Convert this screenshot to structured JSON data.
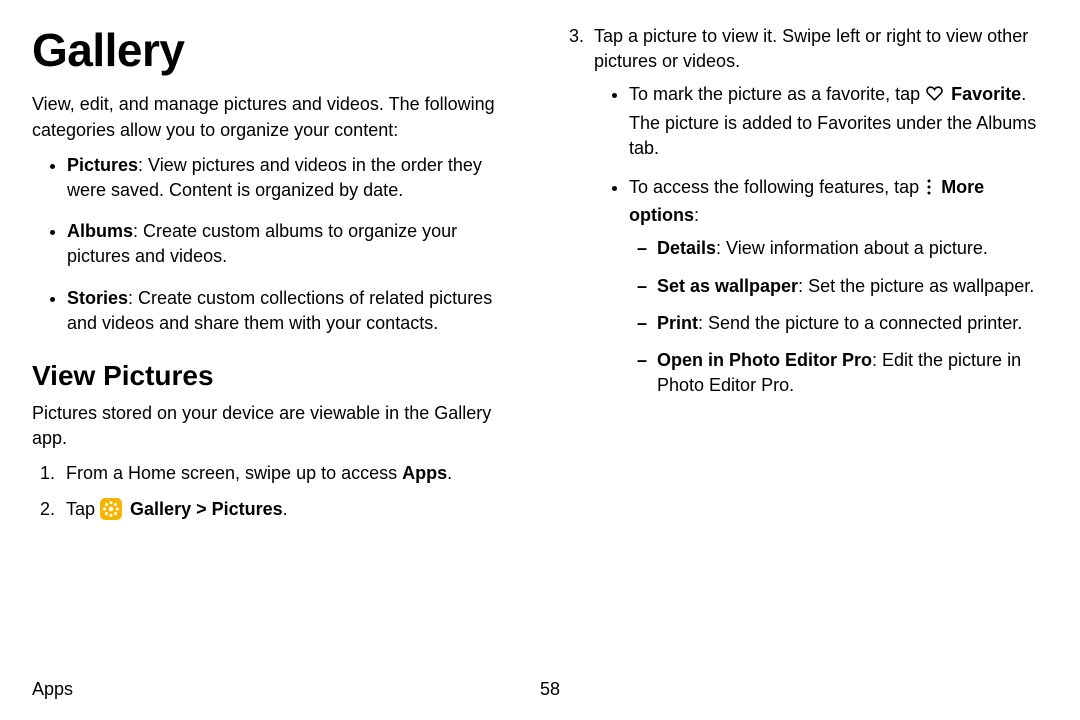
{
  "title": "Gallery",
  "intro": "View, edit, and manage pictures and videos. The following categories allow you to organize your content:",
  "categories": [
    {
      "label": "Pictures",
      "text": ": View pictures and videos in the order they were saved. Content is organized by date."
    },
    {
      "label": "Albums",
      "text": ": Create custom albums to organize your pictures and videos."
    },
    {
      "label": "Stories",
      "text": ": Create custom collections of related pictures and videos and share them with your contacts."
    }
  ],
  "section_view_pictures": {
    "heading": "View Pictures",
    "intro": "Pictures stored on your device are viewable in the Gallery app.",
    "step1_pre": "From a Home screen, swipe up to access ",
    "step1_bold": "Apps",
    "step1_post": ".",
    "step2_pre": "Tap ",
    "step2_bold": "Gallery > Pictures",
    "step2_post": ".",
    "step3_text": "Tap a picture to view it. Swipe left or right to view other pictures or videos.",
    "sub_fav_pre": "To mark the picture as a favorite, tap ",
    "sub_fav_bold": "Favorite",
    "sub_fav_post": ". The picture is added to Favorites under the Albums tab.",
    "sub_more_pre": "To access the following features, tap ",
    "sub_more_bold": "More options",
    "sub_more_post": ":",
    "dash": [
      {
        "label": "Details",
        "text": ": View information about a picture."
      },
      {
        "label": "Set as wallpaper",
        "text": ": Set the picture as wallpaper."
      },
      {
        "label": "Print",
        "text": ": Send the picture to a connected printer."
      },
      {
        "label": "Open in Photo Editor Pro",
        "text": ": Edit the picture in Photo Editor Pro."
      }
    ]
  },
  "footer": {
    "section": "Apps",
    "page": "58"
  }
}
